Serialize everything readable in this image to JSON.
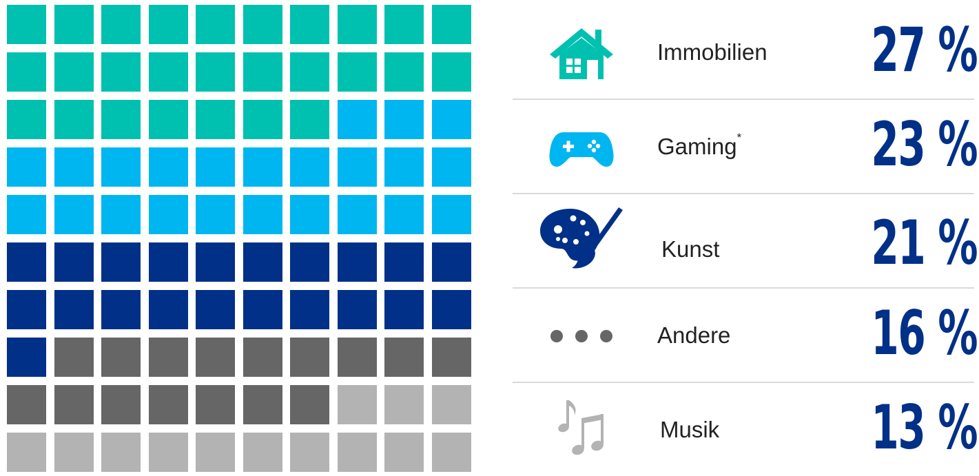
{
  "chart_data": {
    "type": "waffle",
    "grid": {
      "rows": 10,
      "cols": 10
    },
    "categories": [
      {
        "label": "Immobilien",
        "marker": "",
        "value": 27,
        "display": "27 %",
        "color": "#00C0B0",
        "icon": "house-icon"
      },
      {
        "label": "Gaming",
        "marker": "*",
        "value": 23,
        "display": "23 %",
        "color": "#00B6F0",
        "icon": "gamepad-icon"
      },
      {
        "label": "Kunst",
        "marker": "",
        "value": 21,
        "display": "21 %",
        "color": "#003087",
        "icon": "palette-brush-icon"
      },
      {
        "label": "Andere",
        "marker": "",
        "value": 16,
        "display": "16 %",
        "color": "#666666",
        "icon": "more-dots-icon"
      },
      {
        "label": "Musik",
        "marker": "",
        "value": 13,
        "display": "13 %",
        "color": "#B3B3B3",
        "icon": "music-notes-icon"
      }
    ]
  }
}
